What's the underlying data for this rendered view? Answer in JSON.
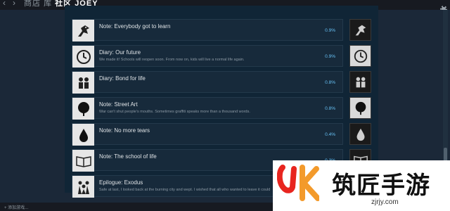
{
  "header": {
    "back_icon": "left-arrow-icon",
    "forward_icon": "right-arrow-icon",
    "crumb_1": "商店",
    "crumb_2": "库",
    "crumb_3": "社区",
    "crumb_4": "JOEY",
    "settings_icon": "gear-icon"
  },
  "achievements": [
    {
      "title": "Note: Everybody got to learn",
      "desc": "",
      "percent": "0.9%",
      "icon": "dragon-icon"
    },
    {
      "title": "Diary: Our future",
      "desc": "We made it! Schools will reopen soon. From now on, kids will live a normal life again.",
      "percent": "0.9%",
      "icon": "clock-icon"
    },
    {
      "title": "Diary: Bond for life",
      "desc": "",
      "percent": "0.8%",
      "icon": "friends-icon"
    },
    {
      "title": "Note: Street Art",
      "desc": "War can't shut people's mouths. Sometimes graffiti speaks more than a thousand words.",
      "percent": "0.8%",
      "icon": "tree-icon"
    },
    {
      "title": "Note: No more tears",
      "desc": "",
      "percent": "0.4%",
      "icon": "teardrop-icon"
    },
    {
      "title": "Note: The school of life",
      "desc": "",
      "percent": "0.3%",
      "icon": "book-icon"
    },
    {
      "title": "Epilogue: Exodus",
      "desc": "Safe at last, I looked back at the burning city and wept. I wished that all who wanted to leave it could",
      "percent": "",
      "icon": "people-icon"
    }
  ],
  "footer": {
    "add_label": "+ 添加游戏..."
  },
  "watermark": {
    "brand": "筑匠手游",
    "site": "zjrjy.com",
    "accent": "#e8251f"
  }
}
